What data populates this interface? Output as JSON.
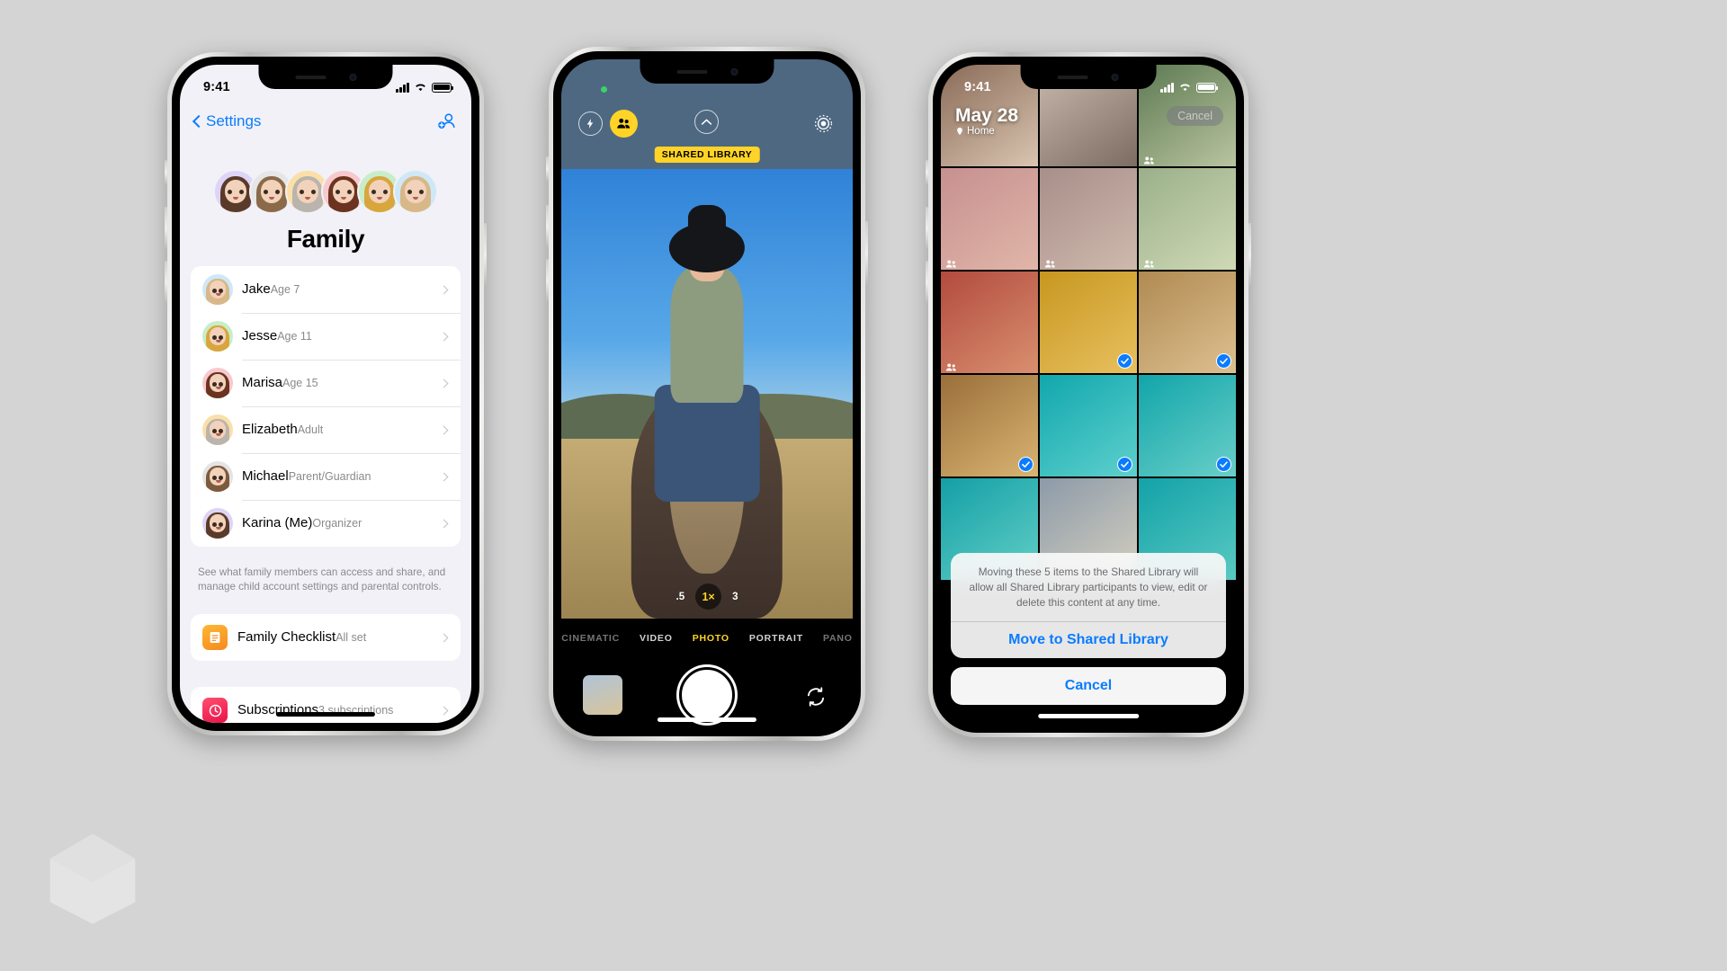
{
  "background_color": "#d4d4d4",
  "accent_blue": "#0a7cff",
  "accent_yellow": "#ffd426",
  "phone1": {
    "name": "settings-family-screen",
    "statusbar": {
      "time": "9:41"
    },
    "nav": {
      "back_label": "Settings",
      "add_member_icon": "add-person-icon"
    },
    "page_title": "Family",
    "memoji_count": 6,
    "members": [
      {
        "name": "Jake",
        "detail": "Age 7",
        "avatar_bg": "#cfe8f7"
      },
      {
        "name": "Jesse",
        "detail": "Age 11",
        "avatar_bg": "#c8edc8"
      },
      {
        "name": "Marisa",
        "detail": "Age 15",
        "avatar_bg": "#f7c9cd"
      },
      {
        "name": "Elizabeth",
        "detail": "Adult",
        "avatar_bg": "#fbdfa8"
      },
      {
        "name": "Michael",
        "detail": "Parent/Guardian",
        "avatar_bg": "#e4e4e4"
      },
      {
        "name": "Karina (Me)",
        "detail": "Organizer",
        "avatar_bg": "#ddd4f5"
      }
    ],
    "footnote": "See what family members can access and share, and manage child account settings and parental controls.",
    "options": [
      {
        "title": "Family Checklist",
        "detail": "All set",
        "icon": "checklist-icon",
        "icon_bg": "#f5a623"
      },
      {
        "title": "Subscriptions",
        "detail": "3 subscriptions",
        "icon": "subscriptions-icon",
        "icon_bg": "#fa2d55"
      }
    ]
  },
  "phone2": {
    "name": "camera-screen",
    "controls": {
      "flash_icon": "flash-icon",
      "shared_library_toggle_icon": "people-icon",
      "chevron_up_icon": "chevron-up-icon",
      "live_photo_icon": "live-photo-icon",
      "flip_camera_icon": "flip-camera-icon",
      "shutter": "shutter-button",
      "thumbnail": "last-photo-thumbnail"
    },
    "shared_library_badge": "SHARED LIBRARY",
    "zoom_levels": [
      {
        "label": ".5",
        "selected": false
      },
      {
        "label": "1×",
        "selected": true
      },
      {
        "label": "3",
        "selected": false
      }
    ],
    "modes": [
      {
        "label": "CINEMATIC",
        "selected": false
      },
      {
        "label": "VIDEO",
        "selected": false
      },
      {
        "label": "PHOTO",
        "selected": true
      },
      {
        "label": "PORTRAIT",
        "selected": false
      },
      {
        "label": "PANO",
        "selected": false
      }
    ]
  },
  "phone3": {
    "name": "photos-shared-library-screen",
    "statusbar": {
      "time": "9:41"
    },
    "header": {
      "date": "May 28",
      "location": "Home",
      "cancel_label": "Cancel"
    },
    "grid": [
      [
        {
          "selected": false,
          "people_badge": false,
          "c1": "#8a6b58",
          "c2": "#d9c5b0"
        },
        {
          "selected": false,
          "people_badge": false,
          "c1": "#c9b9ae",
          "c2": "#7d6c62"
        },
        {
          "selected": false,
          "people_badge": true,
          "c1": "#5d7a52",
          "c2": "#b9c4a0"
        }
      ],
      [
        {
          "selected": false,
          "people_badge": true,
          "c1": "#c79090",
          "c2": "#e0b6a8"
        },
        {
          "selected": false,
          "people_badge": true,
          "c1": "#a8908a",
          "c2": "#cfb8ad"
        },
        {
          "selected": false,
          "people_badge": true,
          "c1": "#9ab08a",
          "c2": "#cfd9b5"
        }
      ],
      [
        {
          "selected": false,
          "people_badge": true,
          "c1": "#b24b3e",
          "c2": "#d98f6f"
        },
        {
          "selected": true,
          "people_badge": false,
          "c1": "#c7971f",
          "c2": "#e8c060"
        },
        {
          "selected": true,
          "people_badge": false,
          "c1": "#b08a52",
          "c2": "#ddc090"
        }
      ],
      [
        {
          "selected": true,
          "people_badge": false,
          "c1": "#9a6f3a",
          "c2": "#d9b472"
        },
        {
          "selected": true,
          "people_badge": false,
          "c1": "#11a7ad",
          "c2": "#5ed0cd"
        },
        {
          "selected": true,
          "people_badge": false,
          "c1": "#12a5aa",
          "c2": "#69cfc8"
        }
      ],
      [
        {
          "selected": false,
          "people_badge": false,
          "c1": "#149fa6",
          "c2": "#62cfc6"
        },
        {
          "selected": false,
          "people_badge": false,
          "c1": "#8c9aa8",
          "c2": "#d4cfc0"
        },
        {
          "selected": false,
          "people_badge": false,
          "c1": "#13a2a8",
          "c2": "#59c9c2"
        }
      ]
    ],
    "dialog": {
      "message": "Moving these 5 items to the Shared Library will allow all Shared Library participants to view, edit or delete this content at any time.",
      "confirm_label": "Move to Shared Library",
      "cancel_label": "Cancel"
    }
  }
}
